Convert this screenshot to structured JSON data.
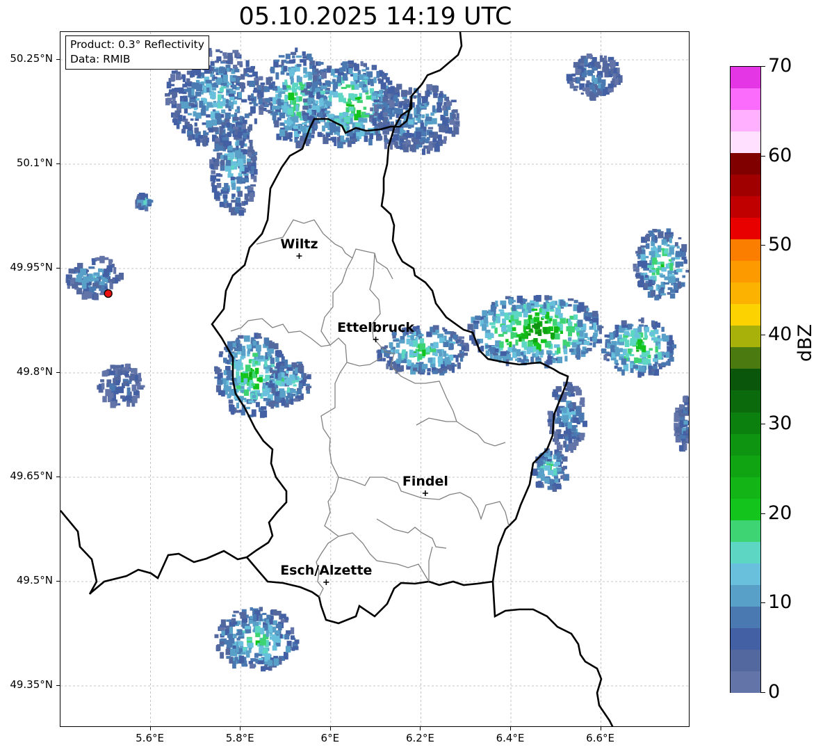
{
  "title": "05.10.2025 14:19 UTC",
  "info": {
    "product": "Product: 0.3° Reflectivity",
    "source": "Data: RMIB"
  },
  "lat_ticks": [
    "50.25°N",
    "50.1°N",
    "49.95°N",
    "49.8°N",
    "49.65°N",
    "49.5°N",
    "49.35°N"
  ],
  "lon_ticks": [
    "5.6°E",
    "5.8°E",
    "6°E",
    "6.2°E",
    "6.4°E",
    "6.6°E"
  ],
  "colorbar": {
    "title": "dBZ",
    "labels": [
      "0",
      "10",
      "20",
      "30",
      "40",
      "50",
      "60",
      "70"
    ],
    "colors": [
      "#6374a8",
      "#52689e",
      "#4460a4",
      "#4a78b0",
      "#58a0c8",
      "#68c0dc",
      "#5ed6c4",
      "#3ed474",
      "#12c41c",
      "#12b416",
      "#10a412",
      "#0e9410",
      "#0c800e",
      "#0b6a0c",
      "#0a560a",
      "#4a7a10",
      "#a8b00a",
      "#fcd200",
      "#fcb200",
      "#fc9a00",
      "#fc7e00",
      "#e80000",
      "#c00000",
      "#a00000",
      "#800000",
      "#ffe0ff",
      "#ffb0ff",
      "#fc6cfc",
      "#e436e4"
    ]
  },
  "map_colors": {
    "border_national": "#000000",
    "border_cantonal": "#808080",
    "gridline": "#b4b4b4",
    "radar_site": "#e81010"
  },
  "cities": [
    {
      "name": "Wiltz",
      "lon": 5.93,
      "lat": 49.968
    },
    {
      "name": "Ettelbruck",
      "lon": 6.1,
      "lat": 49.848
    },
    {
      "name": "Findel",
      "lon": 6.21,
      "lat": 49.627
    },
    {
      "name": "Esch/Alzette",
      "lon": 5.99,
      "lat": 49.499
    }
  ],
  "radar_site": {
    "lon": 5.506,
    "lat": 49.914
  },
  "precip_cells": [
    {
      "lon": 5.74,
      "lat": 50.2,
      "rlon": 0.11,
      "rlat": 0.07,
      "dbz": 14
    },
    {
      "lon": 5.78,
      "lat": 50.1,
      "rlon": 0.05,
      "rlat": 0.07,
      "dbz": 14
    },
    {
      "lon": 5.92,
      "lat": 50.2,
      "rlon": 0.07,
      "rlat": 0.07,
      "dbz": 20
    },
    {
      "lon": 6.04,
      "lat": 50.19,
      "rlon": 0.11,
      "rlat": 0.06,
      "dbz": 22
    },
    {
      "lon": 6.18,
      "lat": 50.17,
      "rlon": 0.1,
      "rlat": 0.05,
      "dbz": 12
    },
    {
      "lon": 6.58,
      "lat": 50.23,
      "rlon": 0.06,
      "rlat": 0.03,
      "dbz": 10
    },
    {
      "lon": 5.58,
      "lat": 50.05,
      "rlon": 0.015,
      "rlat": 0.01,
      "dbz": 16
    },
    {
      "lon": 5.47,
      "lat": 49.94,
      "rlon": 0.06,
      "rlat": 0.03,
      "dbz": 12
    },
    {
      "lon": 5.53,
      "lat": 49.785,
      "rlon": 0.05,
      "rlat": 0.03,
      "dbz": 8
    },
    {
      "lon": 5.82,
      "lat": 49.8,
      "rlon": 0.08,
      "rlat": 0.06,
      "dbz": 22
    },
    {
      "lon": 5.9,
      "lat": 49.79,
      "rlon": 0.05,
      "rlat": 0.03,
      "dbz": 18
    },
    {
      "lon": 6.2,
      "lat": 49.835,
      "rlon": 0.1,
      "rlat": 0.035,
      "dbz": 20
    },
    {
      "lon": 6.45,
      "lat": 49.865,
      "rlon": 0.15,
      "rlat": 0.05,
      "dbz": 28
    },
    {
      "lon": 6.68,
      "lat": 49.84,
      "rlon": 0.08,
      "rlat": 0.04,
      "dbz": 24
    },
    {
      "lon": 6.73,
      "lat": 49.96,
      "rlon": 0.06,
      "rlat": 0.05,
      "dbz": 20
    },
    {
      "lon": 6.52,
      "lat": 49.74,
      "rlon": 0.04,
      "rlat": 0.05,
      "dbz": 12
    },
    {
      "lon": 6.48,
      "lat": 49.665,
      "rlon": 0.04,
      "rlat": 0.03,
      "dbz": 18
    },
    {
      "lon": 6.78,
      "lat": 49.73,
      "rlon": 0.02,
      "rlat": 0.04,
      "dbz": 8
    },
    {
      "lon": 5.83,
      "lat": 49.42,
      "rlon": 0.09,
      "rlat": 0.045,
      "dbz": 18
    }
  ]
}
